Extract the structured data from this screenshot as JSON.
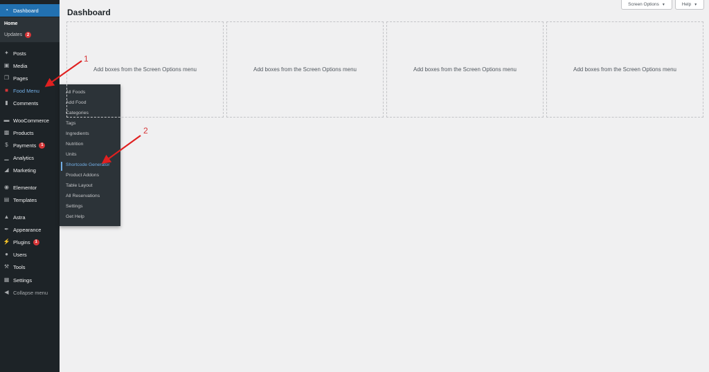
{
  "sidebar": {
    "dashboard": "Dashboard",
    "home": "Home",
    "updates": "Updates",
    "updates_count": "2",
    "posts": "Posts",
    "media": "Media",
    "pages": "Pages",
    "food_menu": "Food Menu",
    "comments": "Comments",
    "woocommerce": "WooCommerce",
    "products": "Products",
    "payments": "Payments",
    "payments_count": "1",
    "analytics": "Analytics",
    "marketing": "Marketing",
    "elementor": "Elementor",
    "templates": "Templates",
    "astra": "Astra",
    "appearance": "Appearance",
    "plugins": "Plugins",
    "plugins_count": "1",
    "users": "Users",
    "tools": "Tools",
    "settings": "Settings",
    "collapse": "Collapse menu"
  },
  "flyout": {
    "items": [
      "All Foods",
      "Add Food",
      "Categories",
      "Tags",
      "Ingredients",
      "Nutrition",
      "Units",
      "Shortcode Generator",
      "Product Addons",
      "Table Layout",
      "All Reservations",
      "Settings",
      "Get Help"
    ],
    "current_index": 7
  },
  "header": {
    "title": "Dashboard",
    "screen_options": "Screen Options",
    "help": "Help"
  },
  "boxes": {
    "text": [
      "Add boxes from the Screen Options menu",
      "Add boxes from the Screen Options menu",
      "Add boxes from the Screen Options menu",
      "Add boxes from the Screen Options menu"
    ]
  },
  "annotations": {
    "one": "1",
    "two": "2"
  },
  "colors": {
    "sidebar_bg": "#1d2327",
    "accent": "#2271b1",
    "highlight_text": "#72aee6",
    "badge": "#d63638",
    "annotation": "#e02020"
  }
}
